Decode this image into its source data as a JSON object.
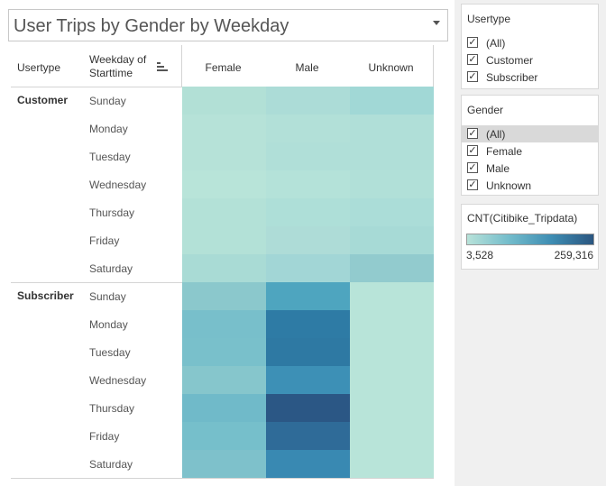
{
  "title": "User Trips by Gender by Weekday",
  "table": {
    "header_usertype": "Usertype",
    "header_weekday_line1": "Weekday of",
    "header_weekday_line2": "Starttime",
    "genders": [
      "Female",
      "Male",
      "Unknown"
    ],
    "days": [
      "Sunday",
      "Monday",
      "Tuesday",
      "Wednesday",
      "Thursday",
      "Friday",
      "Saturday"
    ],
    "groups": [
      {
        "label": "Customer",
        "colors": [
          [
            "#b2e0d6",
            "#acdcd7",
            "#a1d8d6"
          ],
          [
            "#b6e2d8",
            "#b2e0d8",
            "#b0dfd8"
          ],
          [
            "#b6e2d8",
            "#b0dfd8",
            "#b0dfd8"
          ],
          [
            "#b8e4d9",
            "#b4e2d9",
            "#b1e0d8"
          ],
          [
            "#b3e1d7",
            "#aedfd8",
            "#abddd8"
          ],
          [
            "#b3e1d7",
            "#aedcd7",
            "#a7dad6"
          ],
          [
            "#a9dbd5",
            "#a2d6d6",
            "#92cbce"
          ]
        ]
      },
      {
        "label": "Subscriber",
        "colors": [
          [
            "#8bc8cc",
            "#4ea5bf",
            "#b8e4d9"
          ],
          [
            "#78bfcb",
            "#2e7ba5",
            "#b8e4d9"
          ],
          [
            "#79c0cb",
            "#2e79a3",
            "#b8e4d9"
          ],
          [
            "#86c6cc",
            "#3d90b6",
            "#b8e4d9"
          ],
          [
            "#70bac9",
            "#2b5785",
            "#b8e4d9"
          ],
          [
            "#76bfcb",
            "#2f6b98",
            "#b8e4d9"
          ],
          [
            "#7ec1cb",
            "#3989b2",
            "#b8e4d9"
          ]
        ]
      }
    ]
  },
  "filters": {
    "usertype": {
      "title": "Usertype",
      "options": [
        "(All)",
        "Customer",
        "Subscriber"
      ]
    },
    "gender": {
      "title": "Gender",
      "options": [
        "(All)",
        "Female",
        "Male",
        "Unknown"
      ],
      "selected_index": 0
    }
  },
  "legend": {
    "title": "CNT(Citibike_Tripdata)",
    "min": "3,528",
    "max": "259,316",
    "gradient_colors": [
      "#b8e2d9",
      "#73bccb",
      "#3e8db3",
      "#2b5680"
    ]
  }
}
